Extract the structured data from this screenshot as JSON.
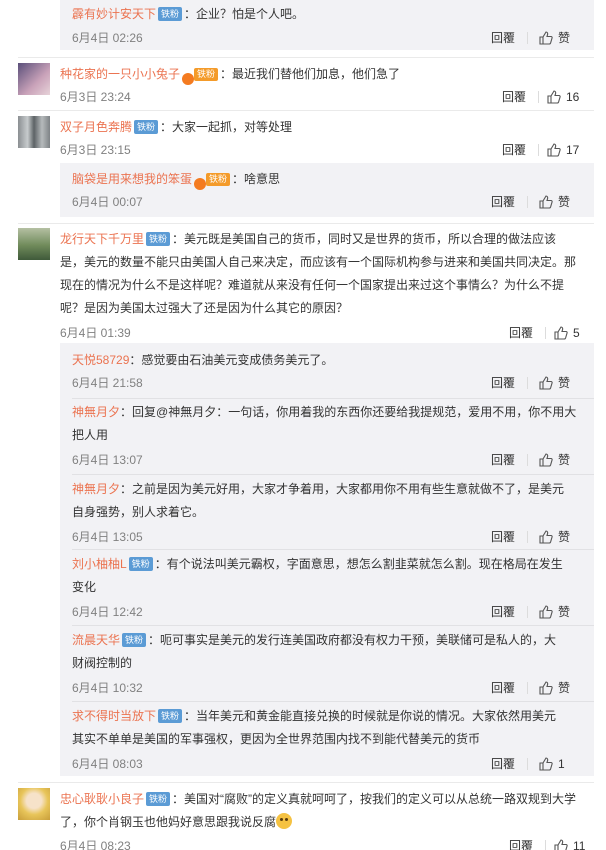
{
  "labels": {
    "reply": "回覆",
    "follower_badge": "铁粉",
    "vip_mark": "vip",
    "fan_badge": "铁粉"
  },
  "top_reply": {
    "user": "霹有妙计安天下",
    "text": "：企业？怕是个人吧。",
    "time": "6月4日 02:26",
    "likes": "赞"
  },
  "comments": [
    {
      "id": "c1",
      "user": "种花家的一只小小兔子",
      "text": "：最近我们替他们加息，他们急了",
      "time": "6月3日 23:24",
      "likes": "16"
    },
    {
      "id": "c2",
      "user": "双子月色奔腾",
      "text": "：大家一起抓，对等处理",
      "time": "6月3日 23:15",
      "likes": "17",
      "replies": [
        {
          "user": "脑袋是用来想我的笨蛋",
          "text": "：啥意思",
          "time": "6月4日 00:07",
          "likes": "赞"
        }
      ]
    },
    {
      "id": "c3",
      "user": "龙行天下千万里",
      "text_lines": [
        "：美元既是美国自己的货币，同时又是世界的货币，所以合理的做法应该",
        "是，美元的数量不能只由美国人自己来决定，而应该有一个国际机构参与进来和美国共同决定。那",
        "现在的情况为什么不是这样呢？难道就从来没有任何一个国家提出来过这个事情么？为什么不提",
        "呢？是因为美国太过强大了还是因为什么其它的原因？"
      ],
      "time": "6月4日 01:39",
      "likes": "5",
      "replies": [
        {
          "user": "天悦58729",
          "lines": [
            "：感觉要由石油美元变成债务美元了。"
          ],
          "time": "6月4日 21:58",
          "likes": "赞"
        },
        {
          "user": "神無月夕",
          "lines": [
            "：回复@神無月夕：一句话，你用着我的东西你还要给我提规范，爱用不用，你不用大",
            "把人用"
          ],
          "time": "6月4日 13:07",
          "likes": "赞"
        },
        {
          "user": "神無月夕",
          "lines": [
            "：之前是因为美元好用，大家才争着用，大家都用你不用有些生意就做不了，是美元",
            "自身强势，别人求着它。"
          ],
          "time": "6月4日 13:05",
          "likes": "赞"
        },
        {
          "user": "刘小柚柚L",
          "lines": [
            "：有个说法叫美元霸权，字面意思，想怎么割韭菜就怎么割。现在格局在发生",
            "变化"
          ],
          "time": "6月4日 12:42",
          "likes": "赞"
        },
        {
          "user": "流晨天华",
          "lines": [
            "：呃可事实是美元的发行连美国政府都没有权力干预，美联储可是私人的，大",
            "财阀控制的"
          ],
          "time": "6月4日 10:32",
          "likes": "赞"
        },
        {
          "user": "求不得时当放下",
          "lines": [
            "：当年美元和黄金能直接兑换的时候就是你说的情况。大家依然用美元",
            "其实不单单是美国的军事强权，更因为全世界范围内找不到能代替美元的货币"
          ],
          "time": "6月4日 08:03",
          "likes": "1"
        }
      ]
    },
    {
      "id": "c4",
      "user": "忠心耿耿小良子",
      "text_lines": [
        "：美国对“腐败”的定义真就呵呵了，按我们的定义可以从总统一路双规到大学",
        "了，你个肖钢玉也他妈好意思跟我说反腐"
      ],
      "time": "6月4日 08:23",
      "likes": "11"
    }
  ],
  "colors": {
    "username": "#eb7350",
    "reply_bg": "#f2f2f5",
    "badge": "#5b9bd5"
  }
}
